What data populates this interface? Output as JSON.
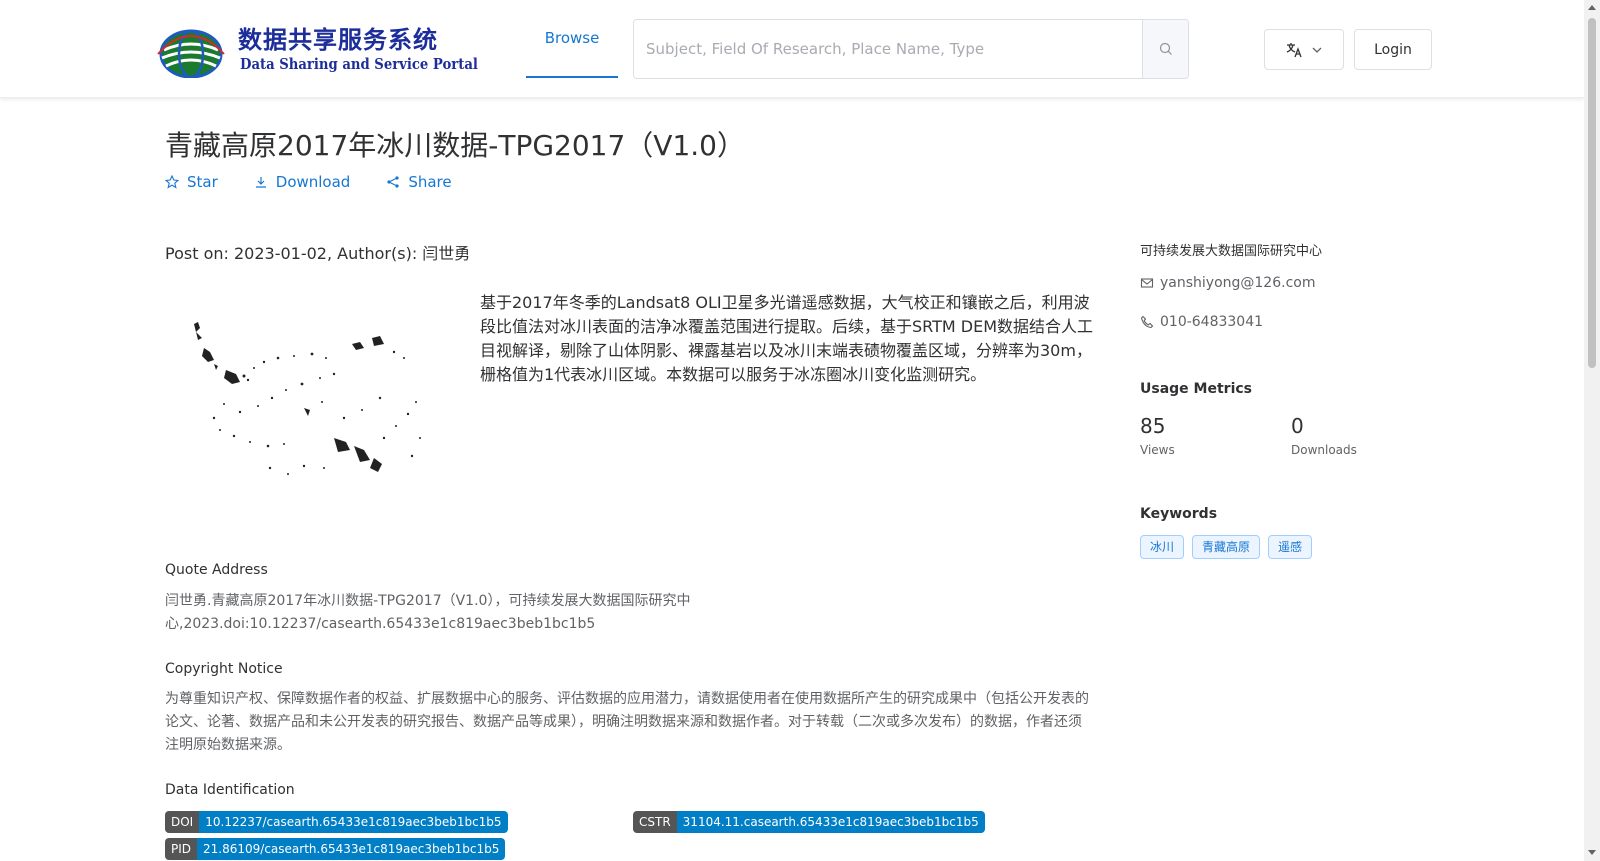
{
  "header": {
    "logo": {
      "cn": "数据共享服务系统",
      "en": "Data Sharing and Service Portal",
      "globe_ring_text": "地球大数据科学数据中心"
    },
    "nav": {
      "browse": "Browse"
    },
    "search": {
      "placeholder": "Subject, Field Of Research, Place Name, Type",
      "value": ""
    },
    "login": "Login"
  },
  "page": {
    "title": "青藏高原2017年冰川数据-TPG2017（V1.0）",
    "actions": {
      "star": "Star",
      "download": "Download",
      "share": "Share"
    },
    "post_on": "Post on: 2023-01-02, Author(s): 闫世勇",
    "description": "基于2017年冬季的Landsat8 OLI卫星多光谱遥感数据，大气校正和镶嵌之后，利用波段比值法对冰川表面的洁净冰覆盖范围进行提取。后续，基于SRTM DEM数据结合人工目视解译，剔除了山体阴影、裸露基岩以及冰川末端表碛物覆盖区域，分辨率为30m，栅格值为1代表冰川区域。本数据可以服务于冰冻圈冰川变化监测研究。",
    "quote": {
      "title": "Quote Address",
      "text": "闫世勇.青藏高原2017年冰川数据-TPG2017（V1.0），可持续发展大数据国际研究中心,2023.doi:10.12237/casearth.65433e1c819aec3beb1bc1b5"
    },
    "copyright": {
      "title": "Copyright Notice",
      "text": "为尊重知识产权、保障数据作者的权益、扩展数据中心的服务、评估数据的应用潜力，请数据使用者在使用数据所产生的研究成果中（包括公开发表的论文、论著、数据产品和未公开发表的研究报告、数据产品等成果），明确注明数据来源和数据作者。对于转载（二次或多次发布）的数据，作者还须注明原始数据来源。"
    },
    "identification": {
      "title": "Data Identification",
      "doi": {
        "label": "DOI",
        "value": "10.12237/casearth.65433e1c819aec3beb1bc1b5"
      },
      "cstr": {
        "label": "CSTR",
        "value": "31104.11.casearth.65433e1c819aec3beb1bc1b5"
      },
      "pid": {
        "label": "PID",
        "value": "21.86109/casearth.65433e1c819aec3beb1bc1b5"
      }
    }
  },
  "sidebar": {
    "org": "可持续发展大数据国际研究中心",
    "email": "yanshiyong@126.com",
    "phone": "010-64833041",
    "usage": {
      "title": "Usage Metrics",
      "views": "85",
      "views_label": "Views",
      "downloads": "0",
      "downloads_label": "Downloads"
    },
    "keywords": {
      "title": "Keywords",
      "items": [
        "冰川",
        "青藏高原",
        "遥感"
      ]
    }
  },
  "colors": {
    "accent": "#1677d2",
    "badge_label": "#555555",
    "badge_value": "#007ec6",
    "logo": "#1d2e9b"
  }
}
